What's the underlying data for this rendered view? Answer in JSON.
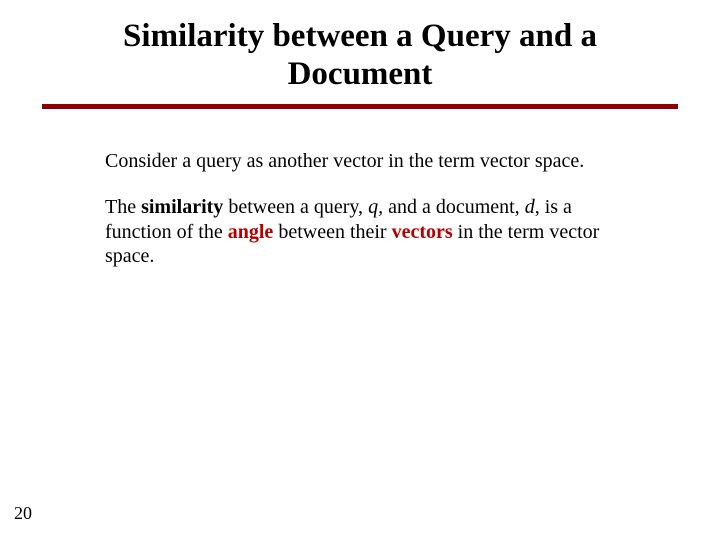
{
  "slide": {
    "title_line1": "Similarity between a Query and a",
    "title_line2": "Document",
    "para1": "Consider a query as another vector in the term vector space.",
    "p2_a": "The ",
    "p2_similarity": "similarity",
    "p2_b": " between a query, ",
    "p2_q": "q,",
    "p2_c": " and a document, ",
    "p2_d": "d",
    "p2_comma": ", ",
    "p2_e": "is a function of the ",
    "p2_angle": "angle",
    "p2_f": " between their ",
    "p2_vectors": "vectors",
    "p2_g": " in the term vector space.",
    "page_number": "20"
  }
}
